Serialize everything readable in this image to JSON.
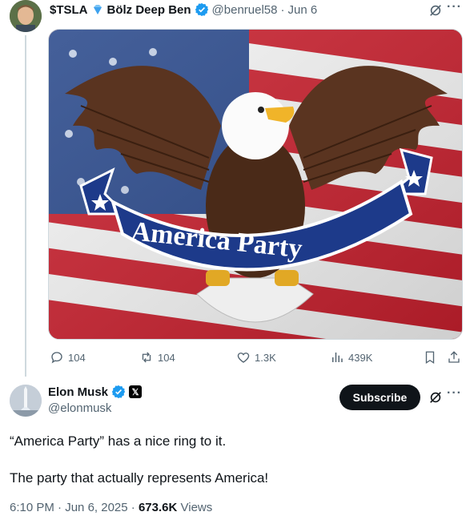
{
  "tweet1": {
    "display_name": "$TSLA",
    "display_name_suffix": "Bölz Deep Ben",
    "handle": "@benruel58",
    "separator": "·",
    "date": "Jun 6",
    "image_alt": "Eagle holding an America Party banner over a US flag",
    "banner_text": "America Party",
    "actions": {
      "replies": "104",
      "reposts": "104",
      "likes": "1.3K",
      "views": "439K"
    }
  },
  "tweet2": {
    "display_name": "Elon Musk",
    "handle": "@elonmusk",
    "subscribe_label": "Subscribe",
    "x_badge": "𝕏",
    "text_line1": "“America Party” has a nice ring to it.",
    "text_line2": "The party that actually represents America!",
    "time": "6:10 PM",
    "separator": "·",
    "date": "Jun 6, 2025",
    "views_count": "673.6K",
    "views_label": "Views"
  },
  "colors": {
    "text_primary": "#0f1419",
    "text_secondary": "#536471",
    "verified_blue": "#1d9bf0",
    "divider": "#cfd9de"
  },
  "icons": {
    "grok": "grok-icon",
    "more": "more-icon",
    "reply": "reply-icon",
    "repost": "repost-icon",
    "like": "like-icon",
    "views": "views-icon",
    "bookmark": "bookmark-icon",
    "share": "share-icon"
  }
}
